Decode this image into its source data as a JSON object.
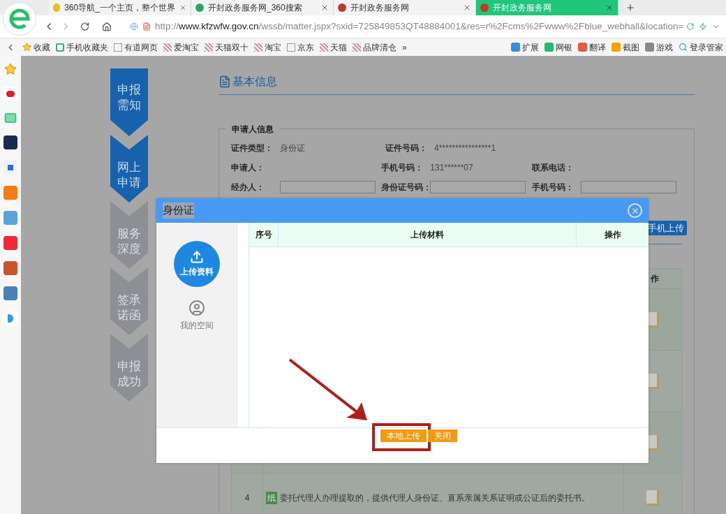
{
  "browser": {
    "tabs": [
      {
        "title": "360导航_一个主页，整个世界",
        "selected": false
      },
      {
        "title": "开封政务服务网_360搜索",
        "selected": false
      },
      {
        "title": "开封政务服务网",
        "selected": false
      },
      {
        "title": "开封政务服务网",
        "selected": true
      }
    ],
    "address": {
      "scheme": "http://",
      "domain": "www.kfzwfw.gov.cn",
      "path": "/wssb/matter.jspx?sxid=725849853QT48884001&res=r%2Fcms%2Fwww%2Fblue_webhall&location="
    },
    "bookmarks": [
      "收藏",
      "手机收藏夹",
      "有道网页",
      "爱淘宝",
      "天猫双十",
      "淘宝",
      "京东",
      "天猫",
      "品牌清仓",
      "»"
    ],
    "tools": [
      "扩展",
      "网银",
      "翻译",
      "截图",
      "游戏",
      "登录管家"
    ]
  },
  "steps": [
    {
      "label": "申报需知",
      "active": true
    },
    {
      "label": "网上申请",
      "active": true
    },
    {
      "label": "服务深度",
      "active": false
    },
    {
      "label": "签承诺函",
      "active": false
    },
    {
      "label": "申报成功",
      "active": false
    }
  ],
  "section_title": "基本信息",
  "applicant": {
    "legend": "申请人信息",
    "rows": [
      [
        {
          "label": "证件类型：",
          "kind": "text",
          "value": "身份证"
        },
        {
          "label": "证件号码：",
          "kind": "text",
          "value": "4****************1"
        }
      ],
      [
        {
          "label": "申请人：",
          "kind": "text"
        },
        {
          "label": "手机号码：",
          "kind": "text",
          "value": "131******07"
        },
        {
          "label": "联系电话：",
          "kind": "text"
        }
      ],
      [
        {
          "label": "经办人：",
          "kind": "input"
        },
        {
          "label": "身份证号码：",
          "kind": "input"
        },
        {
          "label": "手机号码：",
          "kind": "input"
        }
      ]
    ]
  },
  "mobile_upload": "手机上传",
  "materials": {
    "action_header": "作",
    "rows": [
      {
        "kind": "hidden"
      },
      {
        "kind": "hidden"
      },
      {
        "kind": "hidden"
      },
      {
        "kind": "full",
        "number": "4",
        "tag": "纸",
        "text": "委托代理人办理提取的，提供代理人身份证、直系亲属关系证明或公证后的委托书。"
      }
    ]
  },
  "dialog": {
    "title": "身份证",
    "title_text_selected": true,
    "side_items": [
      {
        "label": "上传资料",
        "selected": true
      },
      {
        "label": "我的空间",
        "selected": false
      }
    ],
    "columns": [
      "序号",
      "上传材料",
      "操作"
    ],
    "buttons": [
      {
        "label": "本地上传",
        "highlighted": true
      },
      {
        "label": "关闭",
        "highlighted": false
      }
    ]
  }
}
